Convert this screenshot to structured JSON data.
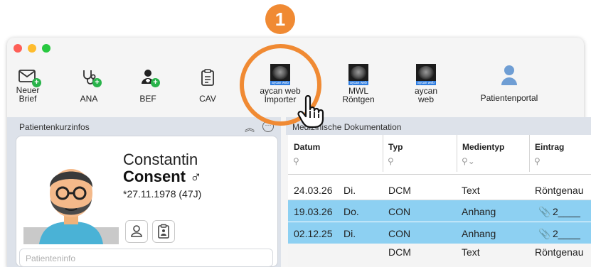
{
  "callout": {
    "number": "1"
  },
  "toolbar": {
    "items": [
      {
        "label": "Neuer\nBrief",
        "icon": "new-letter-icon"
      },
      {
        "label": "ANA",
        "icon": "stethoscope-icon"
      },
      {
        "label": "BEF",
        "icon": "doctor-icon"
      },
      {
        "label": "CAV",
        "icon": "clipboard-icon"
      },
      {
        "label": "aycan web\nImporter",
        "icon": "ct-scan-thumb-icon"
      },
      {
        "label": "MWL\nRöntgen",
        "icon": "ct-scan-thumb-icon"
      },
      {
        "label": "aycan\nweb",
        "icon": "ct-scan-thumb-icon"
      },
      {
        "label": "Patientenportal",
        "icon": "person-icon"
      }
    ],
    "thumb_tag": "aycan web"
  },
  "left_panel": {
    "title": "Patientenkurzinfos",
    "patient": {
      "first_name": "Constantin",
      "last_name": "Consent ♂",
      "dob": "*27.11.1978 (47J)"
    },
    "patientinfo_placeholder": "Patienteninfo"
  },
  "right_panel": {
    "title": "Medizinische Dokumentation",
    "columns": [
      "Datum",
      "Typ",
      "Medientyp",
      "Eintrag"
    ],
    "rows": [
      {
        "datum": "24.03.26",
        "tag": "Di.",
        "typ": "DCM",
        "medientyp": "Text",
        "eintrag": "Röntgenau",
        "selected": false
      },
      {
        "datum": "19.03.26",
        "tag": "Do.",
        "typ": "CON",
        "medientyp": "Anhang",
        "eintrag": "2____",
        "selected": true
      },
      {
        "datum": "02.12.25",
        "tag": "Di.",
        "typ": "CON",
        "medientyp": "Anhang",
        "eintrag": "2____",
        "selected": true
      },
      {
        "datum": "",
        "tag": "",
        "typ": "DCM",
        "medientyp": "Text",
        "eintrag": "Röntgenau",
        "selected": false
      }
    ]
  },
  "colors": {
    "accent": "#f08a33",
    "selection": "#8dd0f2",
    "badge": "#28b34a"
  }
}
